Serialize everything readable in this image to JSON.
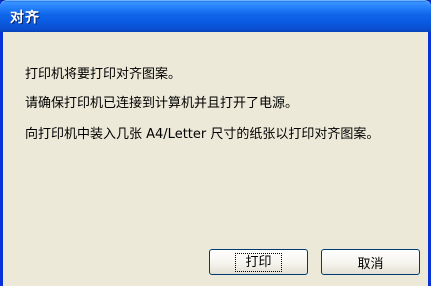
{
  "window": {
    "title": "对齐"
  },
  "messages": {
    "line1": "打印机将要打印对齐图案。",
    "line2": "请确保打印机已连接到计算机并且打开了电源。",
    "line3": "向打印机中装入几张 A4/Letter 尺寸的纸张以打印对齐图案。"
  },
  "buttons": {
    "print_label": "打印",
    "cancel_label": "取消"
  }
}
